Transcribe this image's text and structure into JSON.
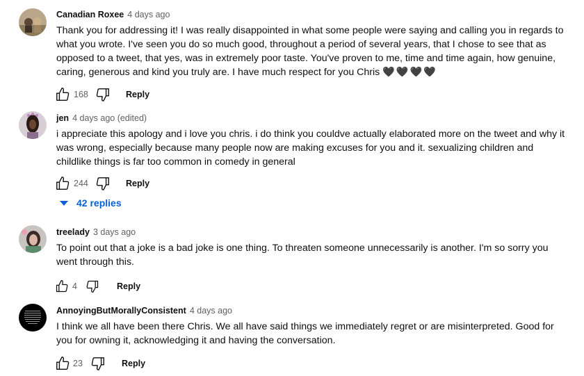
{
  "comments": [
    {
      "author": "Canadian Roxee",
      "time": "4 days ago",
      "text": "Thank you for addressing it!  I was really disappointed in what some people were saying and calling you in regards to what you wrote.  I've seen you do so much good, throughout a period of several years, that I chose to see that as opposed to a tweet, that yes, was in extremely poor taste.  You've proven to me, time and time again, how genuine, caring, generous and kind you truly are.  I have much respect for you Chris",
      "hearts": "🖤🖤🖤🖤",
      "likes": "168",
      "reply_label": "Reply"
    },
    {
      "author": "jen",
      "time": "4 days ago (edited)",
      "text": "i appreciate this apology and i love you chris. i do think you couldve actually elaborated more on the tweet and why it was wrong, especially because many people now are making excuses for you and it. sexualizing children and childlike things is far too common in comedy in general",
      "likes": "244",
      "reply_label": "Reply",
      "replies_label": "42 replies"
    },
    {
      "author": "treelady",
      "time": "3 days ago",
      "text": "To point out that a joke is a bad joke is one thing. To threaten someone unnecessarily is another. I'm so sorry you went through this.",
      "likes": "4",
      "reply_label": "Reply"
    },
    {
      "author": "AnnoyingButMorallyConsistent",
      "time": "4 days ago",
      "text": "I think we all have been there Chris. We all have said things we immediately regret or are misinterpreted. Good for you for owning it, acknowledging it and having the conversation.",
      "likes": "23",
      "reply_label": "Reply"
    }
  ]
}
